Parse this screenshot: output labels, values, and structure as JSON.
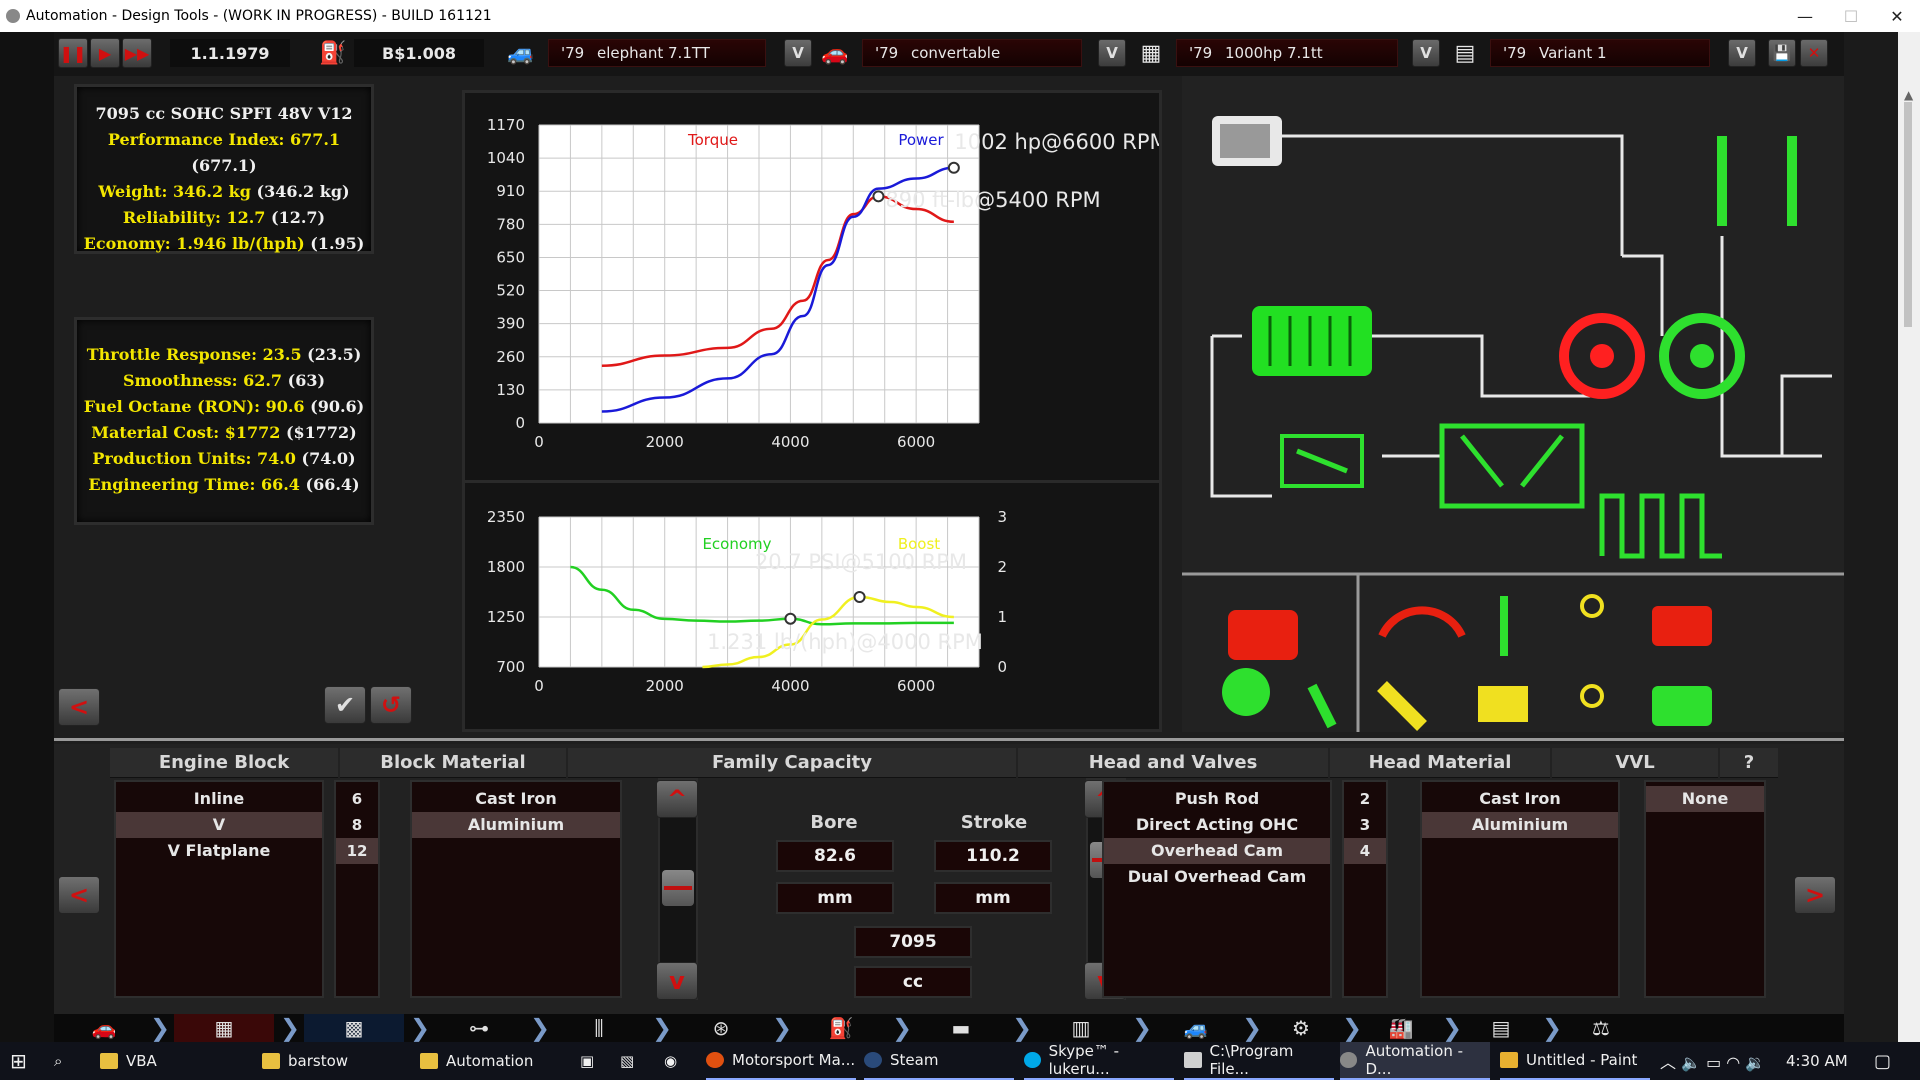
{
  "window": {
    "title": "Automation - Design Tools - (WORK IN PROGRESS) - BUILD 161121",
    "minimize": "—",
    "maximize": "☐",
    "close": "✕"
  },
  "toolbar": {
    "pause_icon": "pause-icon",
    "play_icon": "play-icon",
    "fast_forward_icon": "fast-forward-icon",
    "date": "1.1.1979",
    "money": "B$1.008",
    "car_model": {
      "year": "'79",
      "name": "elephant 7.1TT"
    },
    "car_trim": {
      "year": "'79",
      "name": "convertable"
    },
    "engine_family": {
      "year": "'79",
      "name": "1000hp 7.1tt"
    },
    "engine_variant": {
      "year": "'79",
      "name": "Variant 1"
    },
    "dropdown_label": "V"
  },
  "stats_top": {
    "title": "7095 cc SOHC SPFI 48V V12",
    "rows": [
      {
        "label": "Performance Index: 677.1",
        "extra": "(677.1)"
      },
      {
        "label": "Weight: 346.2 kg",
        "extra": "(346.2 kg)"
      },
      {
        "label": "Reliability: 12.7",
        "extra": "(12.7)"
      },
      {
        "label": "Economy: 1.946 lb/(hph)",
        "extra": "(1.95)"
      }
    ]
  },
  "stats_bottom": {
    "rows": [
      {
        "label": "Throttle Response: 23.5",
        "extra": "(23.5)"
      },
      {
        "label": "Smoothness: 62.7",
        "extra": "(63)"
      },
      {
        "label": "Fuel Octane (RON): 90.6",
        "extra": "(90.6)"
      },
      {
        "label": "Material Cost: $1772",
        "extra": "($1772)"
      },
      {
        "label": "Production Units: 74.0",
        "extra": "(74.0)"
      },
      {
        "label": "Engineering Time: 66.4",
        "extra": "(66.4)"
      }
    ]
  },
  "chart_data": [
    {
      "type": "line",
      "x_ticks": [
        "0",
        "2000",
        "4000",
        "6000"
      ],
      "y_ticks": [
        "1170",
        "1040",
        "910",
        "780",
        "650",
        "520",
        "390",
        "260",
        "130",
        "0"
      ],
      "xlim": [
        0,
        7000
      ],
      "ylim": [
        0,
        1170
      ],
      "grid": true,
      "legend": [
        "Torque",
        "Power"
      ],
      "annotations": [
        "1002 hp@6600 RPM",
        "890 ft-lb@5400 RPM"
      ],
      "series": [
        {
          "name": "Torque",
          "color": "#e01818",
          "x": [
            1000,
            2000,
            3000,
            3700,
            4200,
            4600,
            5000,
            5400,
            6000,
            6600
          ],
          "y": [
            225,
            265,
            295,
            370,
            480,
            640,
            820,
            890,
            840,
            790
          ]
        },
        {
          "name": "Power",
          "color": "#1a1ad8",
          "x": [
            1000,
            2000,
            3000,
            3700,
            4200,
            4600,
            5000,
            5400,
            6000,
            6600
          ],
          "y": [
            45,
            100,
            175,
            270,
            420,
            620,
            810,
            920,
            960,
            1002
          ]
        }
      ]
    },
    {
      "type": "line",
      "x_ticks": [
        "0",
        "2000",
        "4000",
        "6000"
      ],
      "y_ticks_left": [
        "2350",
        "1800",
        "1250",
        "700"
      ],
      "y_ticks_right": [
        "3",
        "2",
        "1",
        "0"
      ],
      "xlim": [
        0,
        7000
      ],
      "ylim": [
        700,
        2350
      ],
      "ylim_right": [
        0,
        3
      ],
      "grid": true,
      "legend": [
        "Economy",
        "Boost"
      ],
      "annotations": [
        "20.7 PSI@5100 RPM",
        "1.231 lb/(hph)@4000 RPM"
      ],
      "series": [
        {
          "name": "Economy",
          "color": "#22d022",
          "x": [
            500,
            1000,
            1500,
            2000,
            2500,
            3000,
            3500,
            4000,
            4500,
            5000,
            5500,
            6000,
            6600
          ],
          "y": [
            1800,
            1550,
            1330,
            1230,
            1210,
            1200,
            1210,
            1231,
            1170,
            1180,
            1180,
            1185,
            1185
          ]
        },
        {
          "name": "Boost",
          "color": "#f0f020",
          "axis": "right",
          "x": [
            2600,
            3000,
            3500,
            4000,
            4500,
            5100,
            5600,
            6000,
            6600
          ],
          "y": [
            0,
            0.05,
            0.2,
            0.45,
            0.95,
            1.4,
            1.3,
            1.2,
            1.0
          ]
        }
      ]
    }
  ],
  "editor": {
    "help": "?",
    "engine_block": {
      "header": "Engine Block",
      "items": [
        "Inline",
        "V",
        "V Flatplane"
      ],
      "selected": 1,
      "counts": [
        "6",
        "8",
        "12"
      ],
      "count_selected": 2
    },
    "block_material": {
      "header": "Block Material",
      "items": [
        "Cast Iron",
        "Aluminium"
      ],
      "selected": 1
    },
    "family_capacity": {
      "header": "Family Capacity",
      "bore_label": "Bore",
      "bore_value": "82.6",
      "bore_unit": "mm",
      "stroke_label": "Stroke",
      "stroke_value": "110.2",
      "stroke_unit": "mm",
      "capacity_value": "7095",
      "capacity_unit": "cc"
    },
    "head_valves": {
      "header": "Head and Valves",
      "items": [
        "Push Rod",
        "Direct Acting OHC",
        "Overhead Cam",
        "Dual Overhead Cam"
      ],
      "selected": 2,
      "counts": [
        "2",
        "3",
        "4"
      ],
      "count_selected": 2
    },
    "head_material": {
      "header": "Head Material",
      "items": [
        "Cast Iron",
        "Aluminium"
      ],
      "selected": 1
    },
    "vvl": {
      "header": "VVL",
      "items": [
        "None"
      ],
      "selected": 0
    }
  },
  "taskbar": {
    "items": [
      "VBA",
      "barstow",
      "Automation",
      "Motorsport Ma...",
      "Steam",
      "Skype™ - lukeru...",
      "C:\\Program File...",
      "Automation - D...",
      "Untitled - Paint"
    ],
    "clock": "4:30 AM"
  },
  "colors": {
    "accent_red": "#d01010",
    "stat_yellow": "#f3e600",
    "torque": "#e01818",
    "power": "#1a1ad8",
    "economy": "#22d022",
    "boost": "#f0f020"
  }
}
